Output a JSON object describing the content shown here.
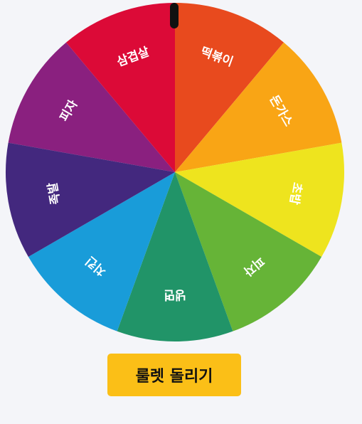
{
  "roulette": {
    "spin_button_label": "룰렛 돌리기",
    "slices": [
      {
        "label": "피자",
        "color": "#8a207f"
      },
      {
        "label": "삼겹살",
        "color": "#dc0a37"
      },
      {
        "label": "떡볶이",
        "color": "#e84a1e"
      },
      {
        "label": "돈가스",
        "color": "#f9a515"
      },
      {
        "label": "초밥",
        "color": "#eee41e"
      },
      {
        "label": "피자",
        "color": "#66b437"
      },
      {
        "label": "냉면",
        "color": "#219468"
      },
      {
        "label": "치킨",
        "color": "#199cd9"
      },
      {
        "label": "족발",
        "color": "#43287e"
      }
    ]
  }
}
